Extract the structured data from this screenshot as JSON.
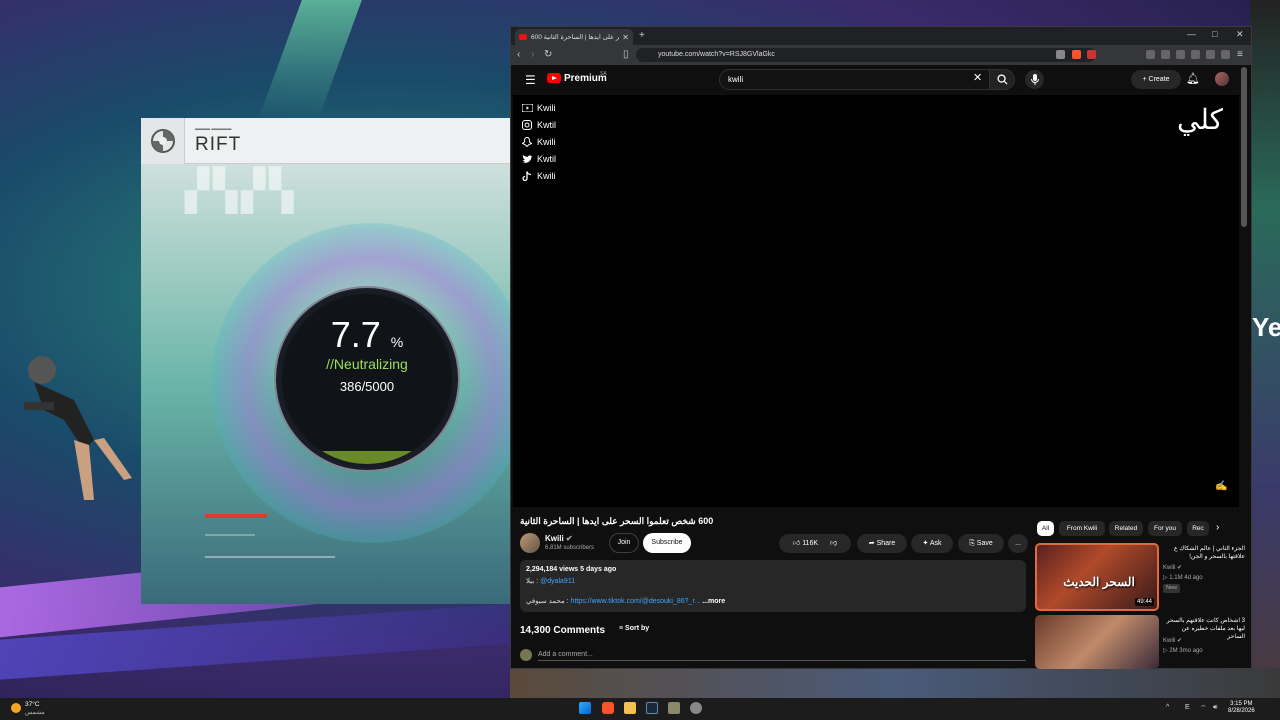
{
  "rift": {
    "title": "RIFT",
    "progress_percent": "7.7",
    "percent_sign": "%",
    "status": "//Neutralizing",
    "count": "386/5000",
    "fill_fraction": 0.077
  },
  "browser": {
    "tab_title": "600 شخص تعلموا السحر على ايدها | الساحرة الثانية",
    "url": "youtube.com/watch?v=RSJ8GVlaGkc",
    "new_tab": "+",
    "window_controls": [
      "—",
      "□",
      "✕"
    ]
  },
  "youtube": {
    "logo_text": "Premium",
    "country_code": "SA",
    "search_value": "kwili",
    "create_label": "Create",
    "social_links": [
      {
        "icon": "youtube-icon",
        "label": "Kwili"
      },
      {
        "icon": "instagram-icon",
        "label": "Kwtil"
      },
      {
        "icon": "snapchat-icon",
        "label": "Kwili"
      },
      {
        "icon": "twitter-icon",
        "label": "Kwtil"
      },
      {
        "icon": "tiktok-icon",
        "label": "Kwili"
      }
    ],
    "video": {
      "title": "600 شخص تعلموا السحر على ايدها | الساحرة الثانية",
      "channel": "Kwili",
      "subscribers": "6.81M subscribers",
      "join_label": "Join",
      "subscribe_label": "Subscribe",
      "likes": "116K",
      "share_label": "Share",
      "ask_label": "Ask",
      "save_label": "Save",
      "more_label": "...",
      "views_date": "2,294,184 views  5 days ago",
      "desc_line1_prefix": "بيلا : ",
      "desc_line1_link": "@dyala911",
      "desc_line2_prefix": "محمد سيوفي : ",
      "desc_line2_link": "https://www.tiktok.com/@desouki_86?_r...",
      "desc_more": "...more"
    },
    "comments_count": "14,300 Comments",
    "sort_label": "Sort by",
    "add_comment_placeholder": "Add a comment...",
    "chips": [
      "All",
      "From Kwili",
      "Related",
      "For you",
      "Rec"
    ],
    "recommendations": [
      {
        "thumb_text": "السحر الحديث",
        "duration": "49:44",
        "title": "الجزء الثاني | عالم الشكاك ع علاقتها بالسحر و الجن!",
        "channel": "Kwili",
        "meta": "▷ 1.1M  4d ago",
        "badge": "New"
      },
      {
        "title": "3 اشخاص كانت علاقتهم بالسحر ليها بعد ملفات خطيره عن الساحر",
        "channel": "Kwili",
        "meta": "▷ 2M  3mo ago"
      }
    ]
  },
  "taskbar": {
    "temperature": "37°C",
    "weather_desc": "مشمس",
    "time": "3:15 PM",
    "date": "8/28/2026",
    "lang": "E"
  },
  "colors": {
    "yt_red": "#ff0000",
    "neutralizing_green": "#9adf5a",
    "link_blue": "#3ea6ff"
  }
}
